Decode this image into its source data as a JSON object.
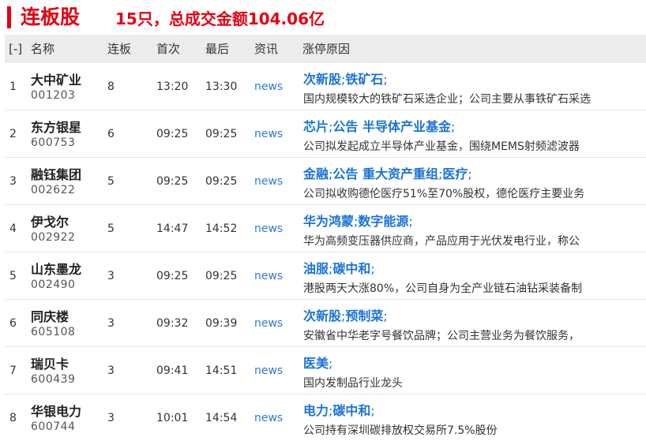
{
  "title": {
    "main": "连板股",
    "summary": "15只，总成交金额104.06亿"
  },
  "header": {
    "toggle": "[-]",
    "name": "名称",
    "lianban": "连板",
    "first": "首次",
    "last": "最后",
    "news": "资讯",
    "reason": "涨停原因"
  },
  "rows": [
    {
      "idx": "1",
      "name": "大中矿业",
      "code": "001203",
      "lianban": "8",
      "first": "13:20",
      "last": "13:30",
      "news": "news",
      "tags": [
        "次新股",
        "铁矿石"
      ],
      "desc": "国内规模较大的铁矿石采选企业；公司主要从事铁矿石采选"
    },
    {
      "idx": "2",
      "name": "东方银星",
      "code": "600753",
      "lianban": "6",
      "first": "09:25",
      "last": "09:25",
      "news": "news",
      "tags": [
        "芯片",
        "公告 半导体产业基金"
      ],
      "desc": "公司拟发起成立半导体产业基金，围绕MEMS射频滤波器"
    },
    {
      "idx": "3",
      "name": "融钰集团",
      "code": "002622",
      "lianban": "5",
      "first": "09:25",
      "last": "09:25",
      "news": "news",
      "tags": [
        "金融",
        "公告 重大资产重组",
        "医疗"
      ],
      "desc": "公司拟收购德伦医疗51%至70%股权，德伦医疗主要业务"
    },
    {
      "idx": "4",
      "name": "伊戈尔",
      "code": "002922",
      "lianban": "5",
      "first": "14:47",
      "last": "14:52",
      "news": "news",
      "tags": [
        "华为鸿蒙",
        "数字能源"
      ],
      "desc": "华为高频变压器供应商，产品应用于光伏发电行业，称公"
    },
    {
      "idx": "5",
      "name": "山东墨龙",
      "code": "002490",
      "lianban": "3",
      "first": "09:25",
      "last": "09:25",
      "news": "news",
      "tags": [
        "油服",
        "碳中和"
      ],
      "desc": "港股两天大涨80%，公司自身为全产业链石油钻采装备制"
    },
    {
      "idx": "6",
      "name": "同庆楼",
      "code": "605108",
      "lianban": "3",
      "first": "09:32",
      "last": "09:39",
      "news": "news",
      "tags": [
        "次新股",
        "预制菜"
      ],
      "desc": "安徽省中华老字号餐饮品牌；公司主营业务为餐饮服务，"
    },
    {
      "idx": "7",
      "name": "瑞贝卡",
      "code": "600439",
      "lianban": "3",
      "first": "09:41",
      "last": "14:51",
      "news": "news",
      "tags": [
        "医美"
      ],
      "desc": "国内发制品行业龙头"
    },
    {
      "idx": "8",
      "name": "华银电力",
      "code": "600744",
      "lianban": "3",
      "first": "10:01",
      "last": "14:54",
      "news": "news",
      "tags": [
        "电力",
        "碳中和"
      ],
      "desc": "公司持有深圳碳排放权交易所7.5%股份"
    }
  ],
  "colors": {
    "title_red": "#e60012",
    "link_blue": "#1a73d9",
    "news_blue": "#2b7bd6",
    "header_bg": "#ececec"
  }
}
